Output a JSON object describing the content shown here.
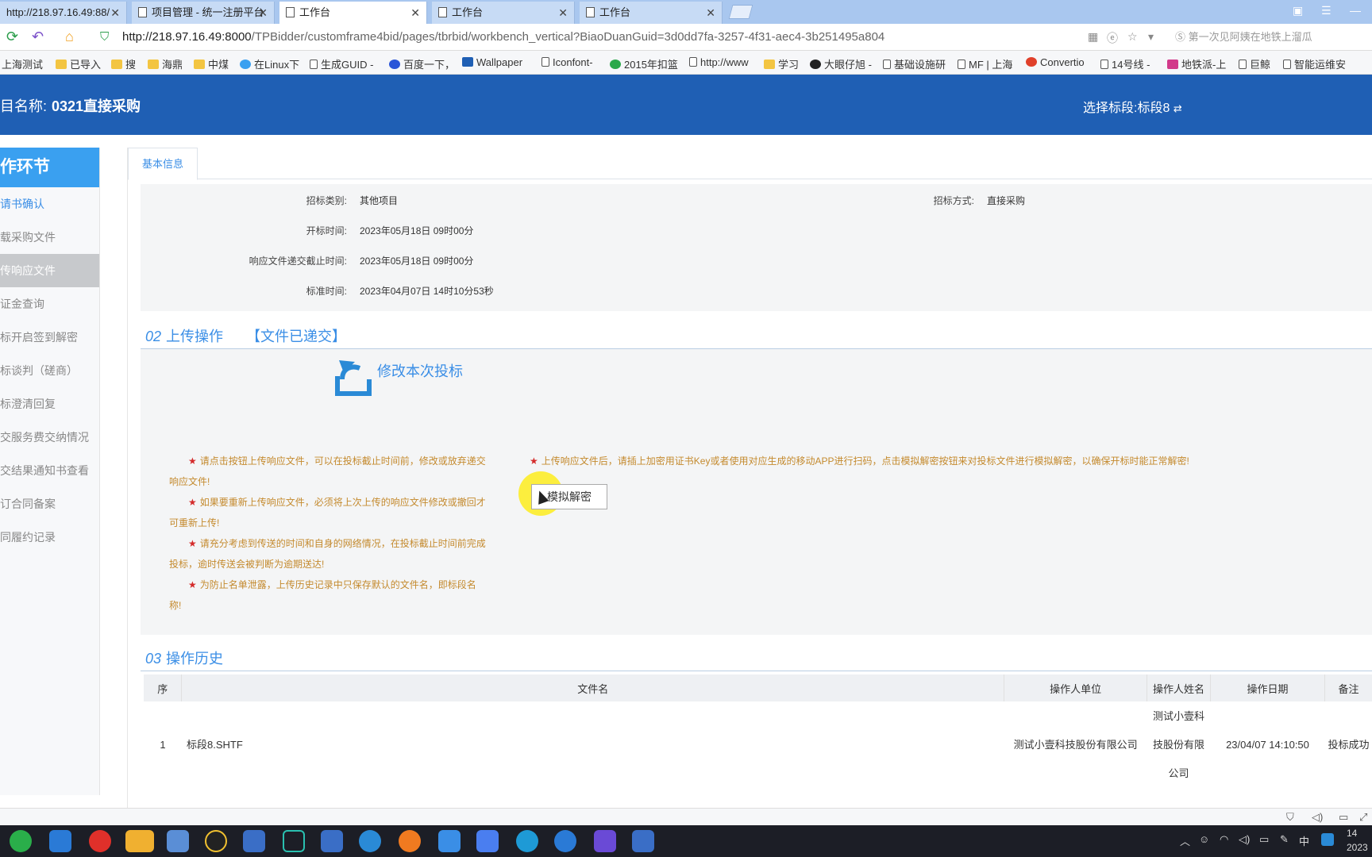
{
  "browser": {
    "tabs": [
      {
        "label": "http://218.97.16.49:88/"
      },
      {
        "label": "项目管理 - 统一注册平台"
      },
      {
        "label": "工作台"
      },
      {
        "label": "工作台"
      },
      {
        "label": "工作台"
      }
    ],
    "url_host": "http://218.97.16.49:8000",
    "url_path": "/TPBidder/customframe4bid/pages/tbrbid/workbench_vertical?BiaoDuanGuid=3d0dd7fa-3257-4f31-aec4-3b251495a804",
    "search_placeholder": "第一次见阿姨在地铁上溜瓜",
    "bookmarks": [
      "上海测试",
      "已导入",
      "搜",
      "海鼎",
      "中煤",
      "在Linux下",
      "生成GUID -",
      "百度一下，",
      "Wallpaper",
      "Iconfont-",
      "2015年扣篮",
      "http://www",
      "学习",
      "大眼仔旭 -",
      "基础设施研",
      "MF | 上海",
      "Convertio",
      "14号线 -",
      "地铁派-上",
      "巨鲸",
      "智能运维安"
    ]
  },
  "header": {
    "project_label": "目名称:",
    "project_name": "0321直接采购",
    "segment_label": "选择标段:",
    "segment_value": "标段8"
  },
  "sidebar": {
    "title": "作环节",
    "items": [
      "请书确认",
      "载采购文件",
      "传响应文件",
      "证金查询",
      "标开启签到解密",
      "标谈判（磋商）",
      "标澄清回复",
      "交服务费交纳情况",
      "交结果通知书查看",
      "订合同备案",
      "同履约记录"
    ]
  },
  "main": {
    "tab_label": "基本信息",
    "info": {
      "category_label": "招标类别:",
      "category_value": "其他项目",
      "method_label": "招标方式:",
      "method_value": "直接采购",
      "open_label": "开标时间:",
      "open_value": "2023年05月18日 09时00分",
      "deadline_label": "响应文件递交截止时间:",
      "deadline_value": "2023年05月18日 09时00分",
      "std_label": "标准时间:",
      "std_value": "2023年04月07日 14时10分53秒"
    },
    "upload": {
      "num": "02",
      "title": "上传操作",
      "status": "【文件已递交】",
      "modify_label": "修改本次投标",
      "tips": [
        "请点击按钮上传响应文件，可以在投标截止时间前，修改或放弃递交响应文件!",
        "如果要重新上传响应文件，必须将上次上传的响应文件修改或撤回才可重新上传!",
        "请充分考虑到传送的时间和自身的网络情况，在投标截止时间前完成投标，逾时传送会被判断为逾期送达!",
        "为防止名单泄露，上传历史记录中只保存默认的文件名，即标段名称!"
      ],
      "tip_right": "上传响应文件后，请插上加密用证书Key或者使用对应生成的移动APP进行扫码，点击模拟解密按钮来对投标文件进行模拟解密，以确保开标时能正常解密!",
      "decrypt_button": "模拟解密"
    },
    "history": {
      "num": "03",
      "title": "操作历史",
      "columns": [
        "序",
        "文件名",
        "操作人单位",
        "操作人姓名",
        "操作日期",
        "备注"
      ],
      "rows": [
        {
          "idx": "1",
          "file": "标段8.SHTF",
          "unit": "测试小壹科技股份有限公司",
          "name": "测试小壹科技股份有限公司",
          "date": "23/04/07 14:10:50",
          "note": "投标成功"
        }
      ]
    }
  },
  "taskbar": {
    "time": "14",
    "date": "2023",
    "ime": "中"
  }
}
